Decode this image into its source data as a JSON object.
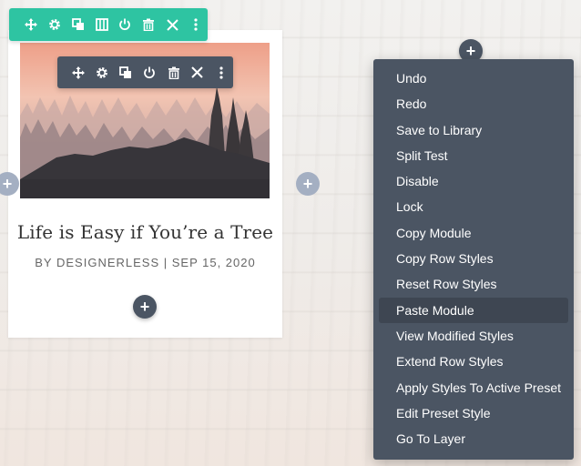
{
  "section_toolbar": {
    "color": "#2ec4a2",
    "icons": [
      "move-icon",
      "gear-icon",
      "duplicate-icon",
      "columns-icon",
      "power-icon",
      "trash-icon",
      "close-icon",
      "more-vertical-icon"
    ]
  },
  "module_toolbar": {
    "color": "#4b5563",
    "icons": [
      "move-icon",
      "gear-icon",
      "duplicate-icon",
      "power-icon",
      "trash-icon",
      "close-icon",
      "more-vertical-icon"
    ]
  },
  "post": {
    "title": "Life is Easy if You’re a Tree",
    "meta": "BY DESIGNERLESS | SEP 15, 2020"
  },
  "add_buttons": {
    "symbol": "+"
  },
  "context_menu": {
    "items": [
      {
        "label": "Undo"
      },
      {
        "label": "Redo"
      },
      {
        "label": "Save to Library"
      },
      {
        "label": "Split Test"
      },
      {
        "label": "Disable"
      },
      {
        "label": "Lock"
      },
      {
        "label": "Copy Module"
      },
      {
        "label": "Copy Row Styles"
      },
      {
        "label": "Reset Row Styles"
      },
      {
        "label": "Paste Module"
      },
      {
        "label": "View Modified Styles"
      },
      {
        "label": "Extend Row Styles"
      },
      {
        "label": "Apply Styles To Active Preset"
      },
      {
        "label": "Edit Preset Style"
      },
      {
        "label": "Go To Layer"
      }
    ],
    "highlighted": "Paste Module"
  }
}
